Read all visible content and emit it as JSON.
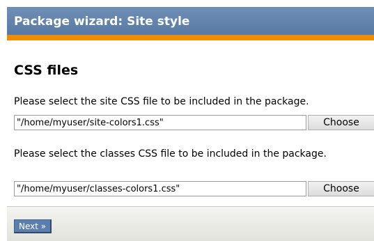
{
  "wizard": {
    "title": "Package wizard: Site style"
  },
  "main": {
    "heading": "CSS files",
    "site_css": {
      "description": "Please select the site CSS file to be included in the package.",
      "value": "\"/home/myuser/site-colors1.css\"",
      "choose_label": "Choose"
    },
    "classes_css": {
      "description": "Please select the classes CSS file to be included in the package.",
      "value": "\"/home/myuser/classes-colors1.css\"",
      "choose_label": "Choose"
    }
  },
  "footer": {
    "next_label": "Next »"
  },
  "colors": {
    "titlebar": "#5f80aa",
    "accent": "#f08c00",
    "next_button": "#5b7eae"
  }
}
